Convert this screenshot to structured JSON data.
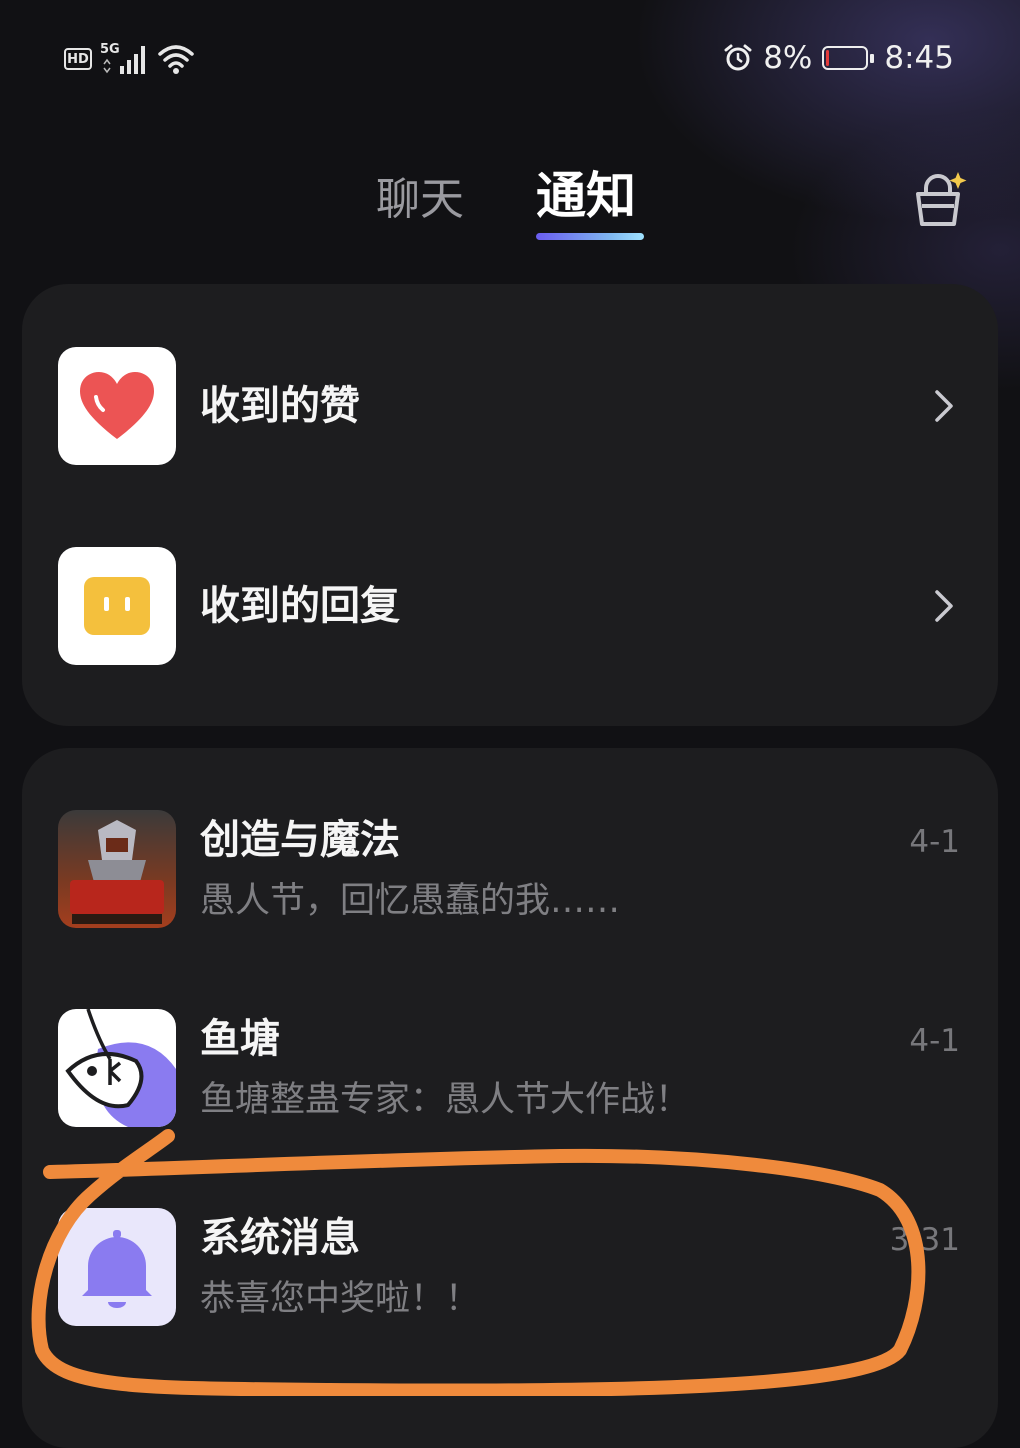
{
  "status_bar": {
    "hd": "HD",
    "network": "5G",
    "battery": "8%",
    "time": "8:45",
    "icons": [
      "hd-icon",
      "signal-5g-icon",
      "wifi-icon",
      "alarm-icon",
      "battery-icon"
    ],
    "battery_level_percent": 8,
    "battery_color": "#e23b3b"
  },
  "header": {
    "tabs": [
      {
        "label": "聊天",
        "active": false
      },
      {
        "label": "通知",
        "active": true
      }
    ],
    "right_icon": "cleanup-basket-icon"
  },
  "quick_entries": [
    {
      "label": "收到的赞",
      "icon": "heart-icon",
      "icon_color": "#ec5454"
    },
    {
      "label": "收到的回复",
      "icon": "reply-bubble-icon",
      "icon_color": "#f4c03d"
    }
  ],
  "notifications": [
    {
      "title": "创造与魔法",
      "preview": "愚人节，回忆愚蠢的我……",
      "date": "4-1",
      "icon": "creation-magic-game-icon"
    },
    {
      "title": "鱼塘",
      "preview": "鱼塘整蛊专家：愚人节大作战！",
      "date": "4-1",
      "icon": "fish-pond-icon"
    },
    {
      "title": "系统消息",
      "preview": "恭喜您中奖啦！！",
      "date": "3-31",
      "icon": "bell-icon"
    }
  ],
  "colors": {
    "background": "#111114",
    "card": "#1d1d1f",
    "accent": "#6a5cf0",
    "annotation": "#ef8a3c"
  }
}
